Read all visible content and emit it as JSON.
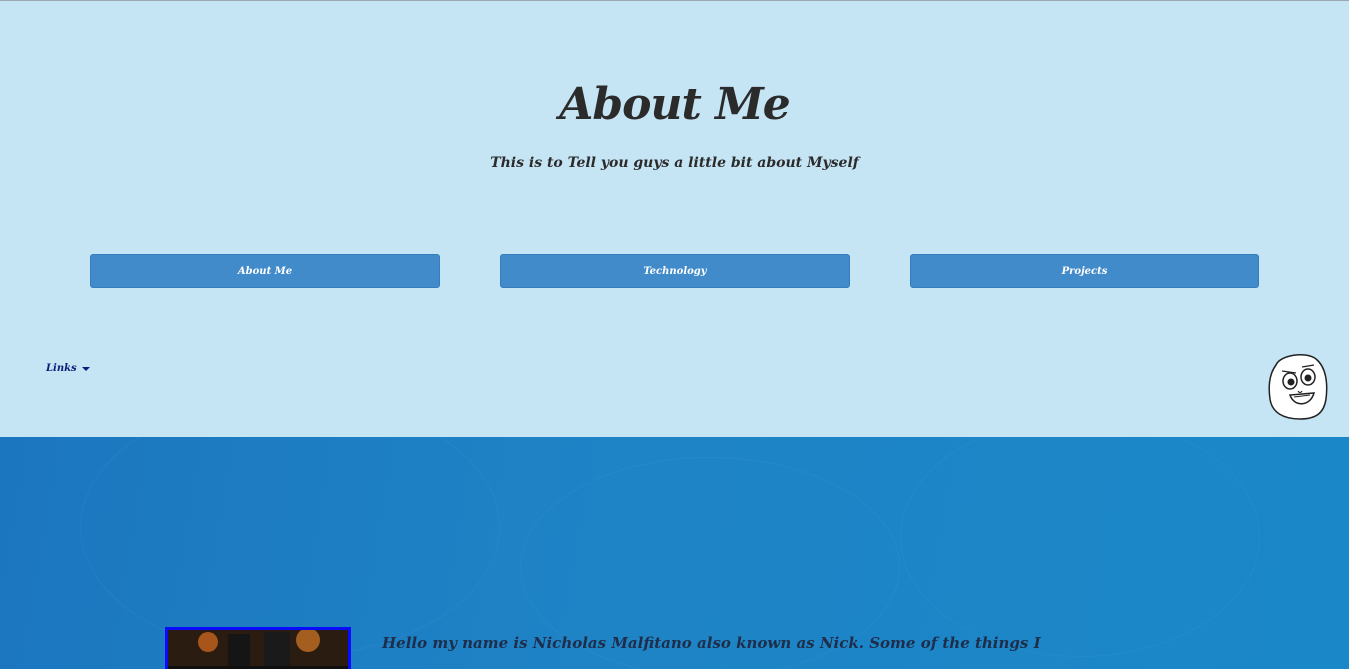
{
  "header": {
    "title": "About Me",
    "subtitle": "This is to Tell you guys a little bit about Myself"
  },
  "nav": {
    "about_label": "About Me",
    "technology_label": "Technology",
    "projects_label": "Projects"
  },
  "links": {
    "label": "Links"
  },
  "content": {
    "intro": "Hello my name is Nicholas Malfitano also known as Nick. Some of the things I"
  },
  "colors": {
    "header_bg": "#c5e4f4",
    "content_bg": "#1e84c6",
    "button_bg": "#428bca",
    "link_text": "#0d1b7a",
    "image_border": "#0a0aff"
  }
}
